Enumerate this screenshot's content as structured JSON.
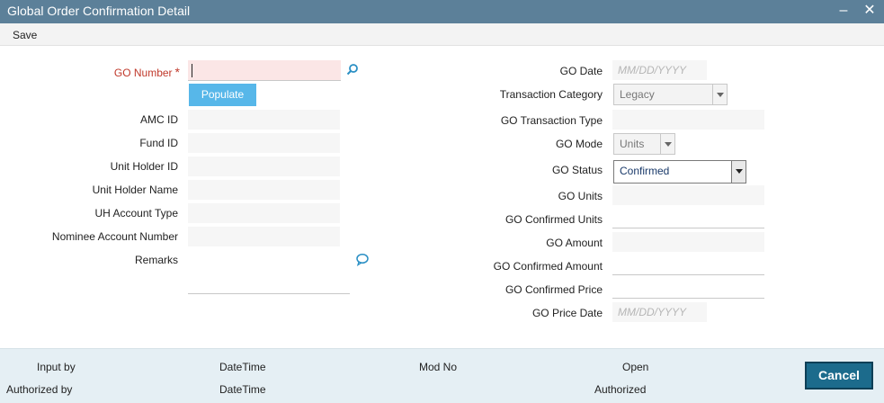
{
  "window": {
    "title": "Global Order Confirmation Detail",
    "minimize_glyph": "–",
    "close_glyph": "✕"
  },
  "toolbar": {
    "save_label": "Save"
  },
  "left_form": {
    "go_number_label": "GO Number",
    "required_mark": "*",
    "populate_label": "Populate",
    "amc_id_label": "AMC ID",
    "fund_id_label": "Fund ID",
    "unit_holder_id_label": "Unit Holder ID",
    "unit_holder_name_label": "Unit Holder Name",
    "uh_account_type_label": "UH Account Type",
    "nominee_account_number_label": "Nominee Account Number",
    "remarks_label": "Remarks"
  },
  "right_form": {
    "go_date_label": "GO Date",
    "go_date_placeholder": "MM/DD/YYYY",
    "transaction_category_label": "Transaction Category",
    "transaction_category_value": "Legacy",
    "go_transaction_type_label": "GO Transaction Type",
    "go_mode_label": "GO Mode",
    "go_mode_value": "Units",
    "go_status_label": "GO Status",
    "go_status_value": "Confirmed",
    "go_units_label": "GO Units",
    "go_confirmed_units_label": "GO Confirmed Units",
    "go_amount_label": "GO Amount",
    "go_confirmed_amount_label": "GO Confirmed Amount",
    "go_confirmed_price_label": "GO Confirmed Price",
    "go_price_date_label": "GO Price Date",
    "go_price_date_placeholder": "MM/DD/YYYY"
  },
  "footer": {
    "input_by": "Input by",
    "authorized_by": "Authorized by",
    "datetime_1": "DateTime",
    "datetime_2": "DateTime",
    "mod_no": "Mod No",
    "open": "Open",
    "authorized": "Authorized",
    "cancel_label": "Cancel"
  },
  "icons": {
    "search": "search-icon",
    "remarks": "speech-bubble-icon"
  },
  "colors": {
    "titlebar": "#5c8099",
    "populate": "#57b7e9",
    "cancel": "#1c6b8c",
    "required": "#c0392b",
    "footer": "#e5eff4"
  }
}
